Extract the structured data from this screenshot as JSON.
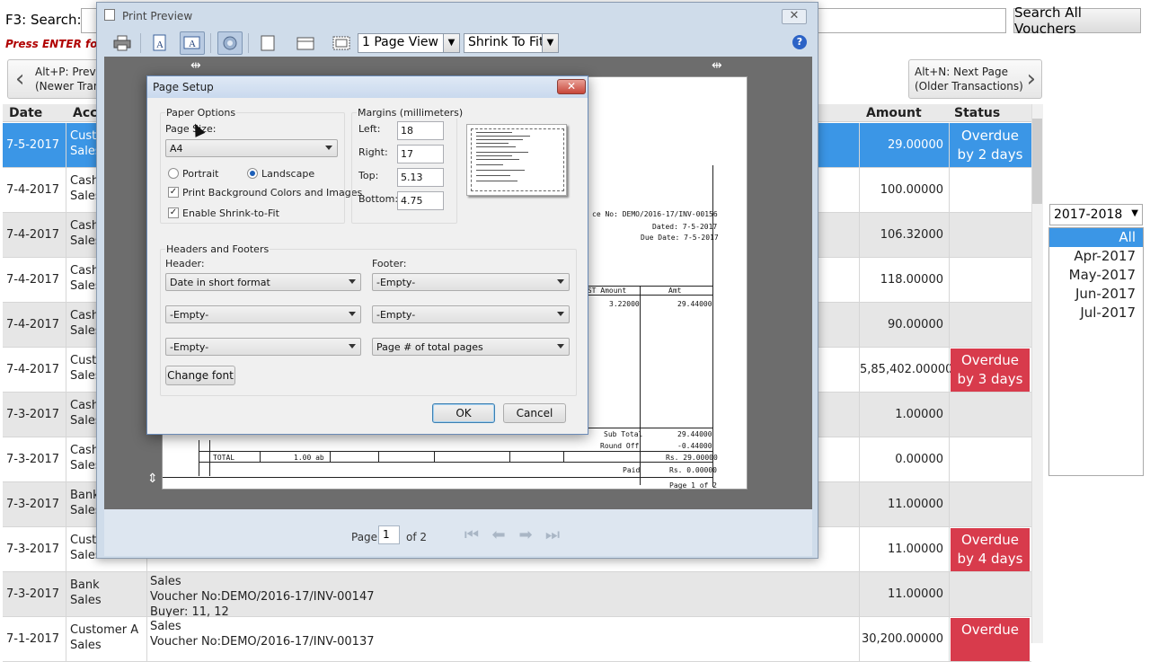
{
  "background_app": {
    "search_label": "F3: Search:",
    "search_all_button": "Search All Vouchers",
    "press_enter_hint": "Press ENTER for",
    "prev_page_line1": "Alt+P: Previ",
    "prev_page_line2": "(Newer Tran",
    "next_page_line1": "Alt+N: Next Page",
    "next_page_line2": "(Older Transactions)",
    "columns": {
      "date": "Date",
      "account": "Acco",
      "amount": "Amount",
      "status": "Status"
    },
    "rows": [
      {
        "date": "7-5-2017",
        "acct1": "Custo",
        "acct2": "Sales",
        "p1": "",
        "p2": "",
        "p3": "",
        "amount": "29.00000",
        "status1": "Overdue",
        "status2": "by 2 days",
        "selected": true
      },
      {
        "date": "7-4-2017",
        "acct1": "Cash",
        "acct2": "Sales",
        "p1": "",
        "p2": "",
        "p3": "",
        "amount": "100.00000",
        "status1": "",
        "status2": ""
      },
      {
        "date": "7-4-2017",
        "acct1": "Cash",
        "acct2": "Sales",
        "p1": "",
        "p2": "",
        "p3": "",
        "amount": "106.32000",
        "status1": "",
        "status2": ""
      },
      {
        "date": "7-4-2017",
        "acct1": "Cash",
        "acct2": "Sales",
        "p1": "",
        "p2": "",
        "p3": "",
        "amount": "118.00000",
        "status1": "",
        "status2": ""
      },
      {
        "date": "7-4-2017",
        "acct1": "Cash",
        "acct2": "Sales",
        "p1": "",
        "p2": "",
        "p3": "",
        "amount": "90.00000",
        "status1": "",
        "status2": ""
      },
      {
        "date": "7-4-2017",
        "acct1": "Custo",
        "acct2": "Sales",
        "p1": "",
        "p2": "",
        "p3": "",
        "amount": "5,85,402.00000",
        "status1": "Overdue",
        "status2": "by 3 days"
      },
      {
        "date": "7-3-2017",
        "acct1": "Cash",
        "acct2": "Sales",
        "p1": "",
        "p2": "",
        "p3": "",
        "amount": "1.00000",
        "status1": "",
        "status2": ""
      },
      {
        "date": "7-3-2017",
        "acct1": "Cash",
        "acct2": "Sales",
        "p1": "",
        "p2": "",
        "p3": "",
        "amount": "0.00000",
        "status1": "",
        "status2": ""
      },
      {
        "date": "7-3-2017",
        "acct1": "Bank",
        "acct2": "Sales",
        "p1": "",
        "p2": "",
        "p3": "",
        "amount": "11.00000",
        "status1": "",
        "status2": ""
      },
      {
        "date": "7-3-2017",
        "acct1": "Custo",
        "acct2": "Sales",
        "p1": "",
        "p2": "",
        "p3": "",
        "amount": "11.00000",
        "status1": "Overdue",
        "status2": "by 4 days"
      },
      {
        "date": "7-3-2017",
        "acct1": "Bank",
        "acct2": "Sales",
        "p1": "Sales",
        "p2": "Voucher No:DEMO/2016-17/INV-00147",
        "p3": "Buyer: 11, 12",
        "amount": "11.00000",
        "status1": "",
        "status2": ""
      },
      {
        "date": "7-1-2017",
        "acct1": "Customer A",
        "acct2": "Sales",
        "p1": "Sales",
        "p2": "Voucher No:DEMO/2016-17/INV-00137",
        "p3": "",
        "amount": "30,200.00000",
        "status1": "Overdue",
        "status2": ""
      }
    ],
    "year_select": "2017-2018",
    "months": [
      "All",
      "Apr-2017",
      "May-2017",
      "Jun-2017",
      "Jul-2017"
    ]
  },
  "print_preview": {
    "title": "Print Preview",
    "close_label": "✕",
    "view_select": "1 Page View",
    "fit_select": "Shrink To Fit",
    "help_label": "?",
    "page_label": "Page",
    "page_value": "1",
    "page_of": "of 2",
    "paper": {
      "invoice_no": "ce No: DEMO/2016-17/INV-00156",
      "dated": "Dated: 7-5-2017",
      "due_date": "Due Date: 7-5-2017",
      "col_gst": "GST Amount",
      "col_amt": "Amt",
      "gst_value": "3.22000",
      "amt_value": "29.44000",
      "sub_total_label": "Sub Total",
      "sub_total_value": "29.44000",
      "round_off_label": "Round Off",
      "round_off_value": "-0.44000",
      "total_label": "TOTAL",
      "total_qty": "1.00 ab",
      "total_value": "Rs. 29.00000",
      "paid_label": "Paid",
      "paid_value": "Rs. 0.00000",
      "page_footer": "Page 1 of 2"
    }
  },
  "page_setup": {
    "title": "Page Setup",
    "close_label": "✕",
    "paper_options_label": "Paper Options",
    "page_size_label": "Page Size:",
    "page_size_value": "A4",
    "portrait_label": "Portrait",
    "landscape_label": "Landscape",
    "print_bg_label": "Print Background Colors and Images",
    "shrink_label": "Enable Shrink-to-Fit",
    "margins_label": "Margins (millimeters)",
    "left_label": "Left:",
    "left_value": "18",
    "right_label": "Right:",
    "right_value": "17",
    "top_label": "Top:",
    "top_value": "5.13",
    "bottom_label": "Bottom:",
    "bottom_value": "4.75",
    "headers_footers_label": "Headers and Footers",
    "header_label": "Header:",
    "footer_label": "Footer:",
    "header_values": [
      "Date in short format",
      "-Empty-",
      "-Empty-"
    ],
    "footer_values": [
      "-Empty-",
      "-Empty-",
      "Page # of total pages"
    ],
    "change_font_label": "Change font",
    "ok_label": "OK",
    "cancel_label": "Cancel"
  },
  "colors": {
    "selection_blue": "#3b96e6",
    "overdue_red": "#d83b4c"
  }
}
